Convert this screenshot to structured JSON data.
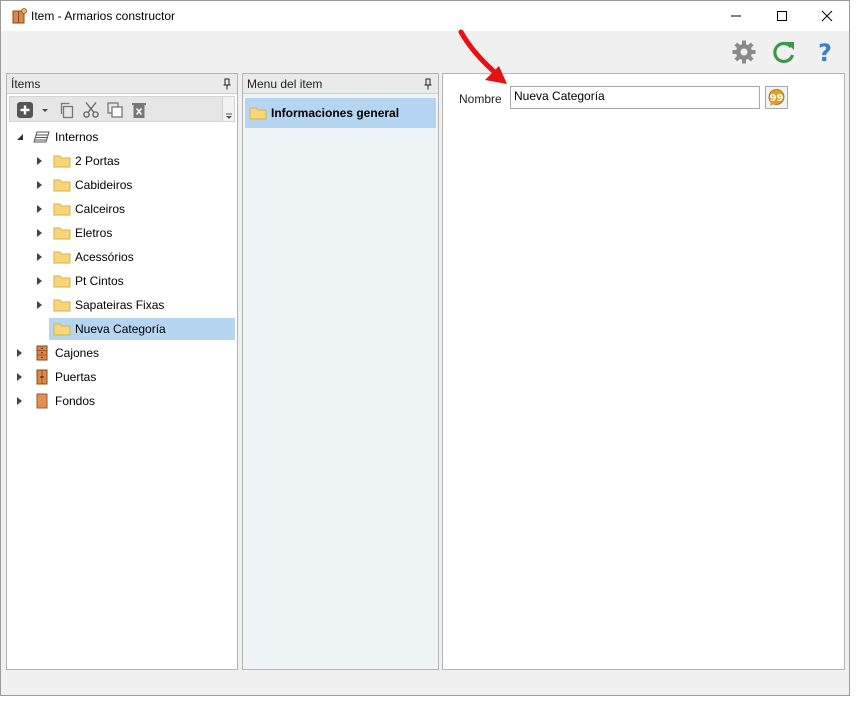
{
  "window": {
    "title": "Item - Armarios constructor"
  },
  "toolbar": {
    "icons": [
      "gear-icon",
      "refresh-icon",
      "help-icon"
    ],
    "accent_green": "#3a9a4a",
    "accent_blue": "#3a82c4"
  },
  "items_panel": {
    "header": "Ítems",
    "tree": [
      {
        "label": "Internos",
        "icon": "stack-icon",
        "expanded": true
      },
      {
        "label": "2 Portas",
        "icon": "folder-icon"
      },
      {
        "label": "Cabideiros",
        "icon": "folder-icon"
      },
      {
        "label": "Calceiros",
        "icon": "folder-icon"
      },
      {
        "label": "Eletros",
        "icon": "folder-icon"
      },
      {
        "label": "Acessórios",
        "icon": "folder-icon"
      },
      {
        "label": "Pt Cintos",
        "icon": "folder-icon"
      },
      {
        "label": "Sapateiras Fixas",
        "icon": "folder-icon"
      },
      {
        "label": "Nueva Categoría",
        "icon": "folder-icon",
        "selected": true
      },
      {
        "label": "Cajones",
        "icon": "drawer-icon"
      },
      {
        "label": "Puertas",
        "icon": "door-icon"
      },
      {
        "label": "Fondos",
        "icon": "panel-icon"
      }
    ]
  },
  "menu_panel": {
    "header": "Menu del item",
    "items": [
      {
        "label": "Informaciones general",
        "selected": true
      }
    ]
  },
  "detail": {
    "nombre_label": "Nombre",
    "nombre_value": "Nueva Categoría"
  },
  "colors": {
    "selection": "#b5d5f0",
    "folder": "#f5d77a",
    "wood": "#d98a4a",
    "annotation_arrow": "#e81010"
  }
}
